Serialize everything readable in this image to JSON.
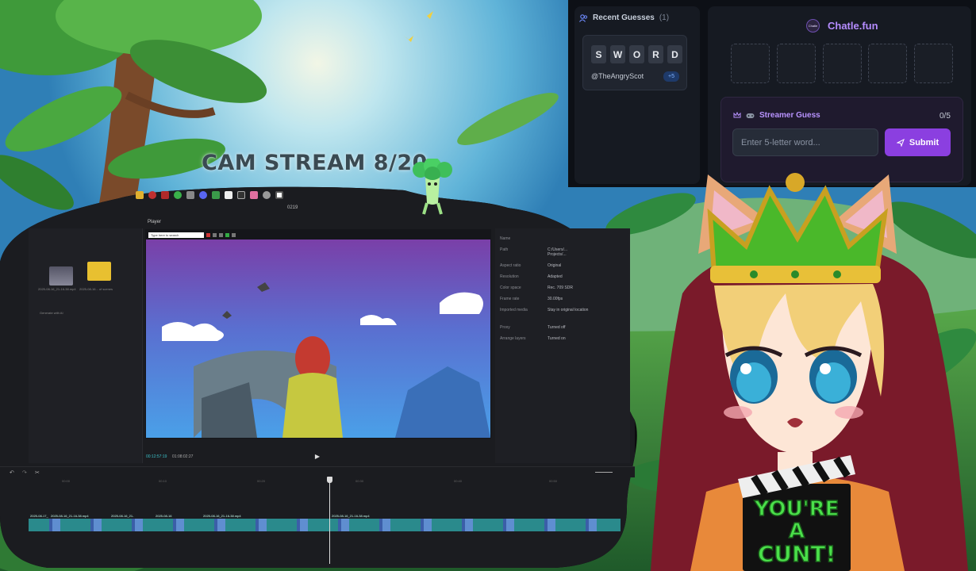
{
  "stream": {
    "title": "CAM STREAM 8/20"
  },
  "chatle": {
    "brand": "Chatle.fun",
    "brand_logo_text": "Chatle",
    "recent_guesses": {
      "label": "Recent Guesses",
      "count": "(1)",
      "items": [
        {
          "letters": [
            "S",
            "W",
            "O",
            "R",
            "D"
          ],
          "user": "@TheAngryScot",
          "points": "+5"
        }
      ]
    },
    "streamer_guess": {
      "label": "Streamer Guess",
      "count": "0/5",
      "placeholder": "Enter 5-letter word...",
      "submit": "Submit"
    },
    "colors": {
      "accent": "#b58cff",
      "submit": "#8b3fe0",
      "panel": "#161a22"
    }
  },
  "editor": {
    "window_title": "0219",
    "player_label": "Player",
    "search_placeholder": "Type here to search",
    "time_current": "00:12:57:19",
    "time_total": "01:08:02:27",
    "media_bin": [
      {
        "label": "2025-08-16_21-16-38.mp4"
      },
      {
        "label": "2025-08-16... of scenes"
      }
    ],
    "import_label": "Generate with AI",
    "properties": [
      {
        "key": "Name",
        "value": ""
      },
      {
        "key": "Path",
        "value": "C:/Users/... Projects/..."
      },
      {
        "key": "Aspect ratio",
        "value": "Original"
      },
      {
        "key": "Resolution",
        "value": "Adapted"
      },
      {
        "key": "Color space",
        "value": "Rec. 709 SDR"
      },
      {
        "key": "Frame rate",
        "value": "30.00fps"
      },
      {
        "key": "Imported media",
        "value": "Stay in original location"
      },
      {
        "key": "Proxy",
        "value": "Turned off"
      },
      {
        "key": "Arrange layers",
        "value": "Turned on"
      }
    ],
    "ruler": [
      "00:00",
      "00:10",
      "00:20",
      "00:30",
      "00:40",
      "00:50"
    ],
    "clip_labels": [
      "2025-08-17_",
      "2025-08-16_21-16-38.mp4",
      "2025-08-16_21-",
      "2025-08-16",
      "2025-08-16_21-16-38.mp4",
      "2025-08-16_21-16-38.mp4"
    ]
  },
  "vtuber": {
    "clapper_line1": "YOU'RE",
    "clapper_line2": "A",
    "clapper_line3": "CUNT!"
  }
}
